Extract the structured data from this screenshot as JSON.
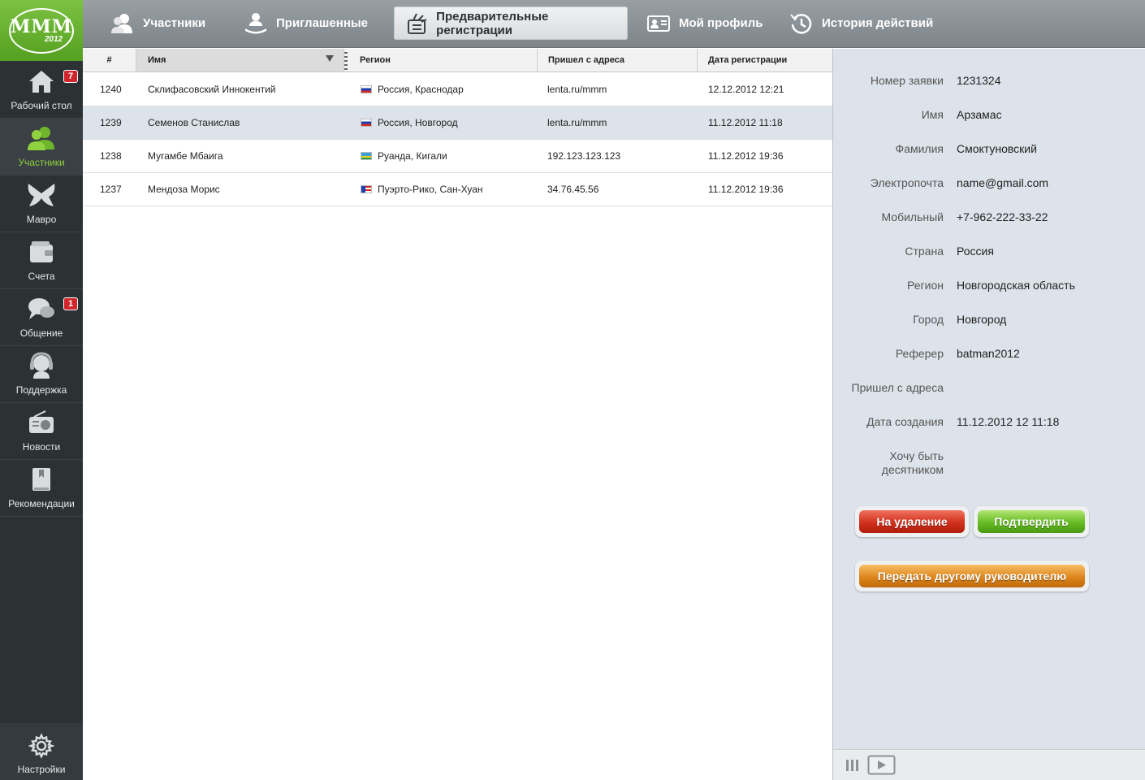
{
  "logo": {
    "text": "МММ",
    "year": "2012"
  },
  "sidebar": {
    "items": [
      {
        "label": "Рабочий стол",
        "badge": "7",
        "icon": "home-icon"
      },
      {
        "label": "Участники",
        "badge": "",
        "icon": "users-icon",
        "active": true
      },
      {
        "label": "Мавро",
        "badge": "",
        "icon": "butterfly-icon"
      },
      {
        "label": "Счета",
        "badge": "",
        "icon": "wallet-icon"
      },
      {
        "label": "Общение",
        "badge": "1",
        "icon": "chat-icon"
      },
      {
        "label": "Поддержка",
        "badge": "",
        "icon": "headset-icon"
      },
      {
        "label": "Новости",
        "badge": "",
        "icon": "radio-icon"
      },
      {
        "label": "Рекомендации",
        "badge": "",
        "icon": "book-icon"
      }
    ],
    "settings_label": "Настройки"
  },
  "tabs": [
    {
      "label": "Участники",
      "icon": "users-icon"
    },
    {
      "label": "Приглашенные",
      "icon": "invited-icon"
    },
    {
      "label": "Предварительные регистрации",
      "icon": "registration-icon",
      "active": true
    },
    {
      "label": "Мой профиль",
      "icon": "profile-card-icon"
    },
    {
      "label": "История действий",
      "icon": "history-icon"
    }
  ],
  "table": {
    "headers": [
      "#",
      "Имя",
      "Регион",
      "Пришел с адреса",
      "Дата регистрации"
    ],
    "rows": [
      {
        "id": "1240",
        "name": "Склифасовский Иннокентий",
        "flag": "ru",
        "region": "Россия, Краснодар",
        "source": "lenta.ru/mmm",
        "date": "12.12.2012 12:21"
      },
      {
        "id": "1239",
        "name": "Семенов Станислав",
        "flag": "ru",
        "region": "Россия, Новгород",
        "source": "lenta.ru/mmm",
        "date": "11.12.2012 11:18",
        "selected": true
      },
      {
        "id": "1238",
        "name": "Мугамбе Мбаига",
        "flag": "rw",
        "region": "Руанда, Кигали",
        "source": "192.123.123.123",
        "date": "11.12.2012 19:36"
      },
      {
        "id": "1237",
        "name": "Мендоза Морис",
        "flag": "pr",
        "region": "Пуэрто-Рико, Сан-Хуан",
        "source": "34.76.45.56",
        "date": "11.12.2012 19:36"
      }
    ]
  },
  "detail": {
    "fields": [
      {
        "label": "Номер заявки",
        "value": "1231324"
      },
      {
        "label": "Имя",
        "value": "Арзамас"
      },
      {
        "label": "Фамилия",
        "value": "Смоктуновский"
      },
      {
        "label": "Электропочта",
        "value": "name@gmail.com"
      },
      {
        "label": "Мобильный",
        "value": "+7-962-222-33-22"
      },
      {
        "label": "Страна",
        "value": "Россия"
      },
      {
        "label": "Регион",
        "value": "Новгородская область"
      },
      {
        "label": "Город",
        "value": "Новгород"
      },
      {
        "label": "Реферер",
        "value": "batman2012"
      },
      {
        "label": "Пришел с адреса",
        "value": ""
      },
      {
        "label": "Дата создания",
        "value": "11.12.2012 12 11:18"
      },
      {
        "label": "Хочу быть десятником",
        "value": ""
      }
    ],
    "buttons": {
      "delete": "На удаление",
      "confirm": "Подтвердить",
      "transfer": "Передать другому руководителю"
    }
  },
  "colors": {
    "sidebar_bg": "#2c3134",
    "accent_green": "#7cc242",
    "active_nav_text": "#8fd13e",
    "badge_red": "#d0252b",
    "selected_row": "#dde3ea"
  }
}
